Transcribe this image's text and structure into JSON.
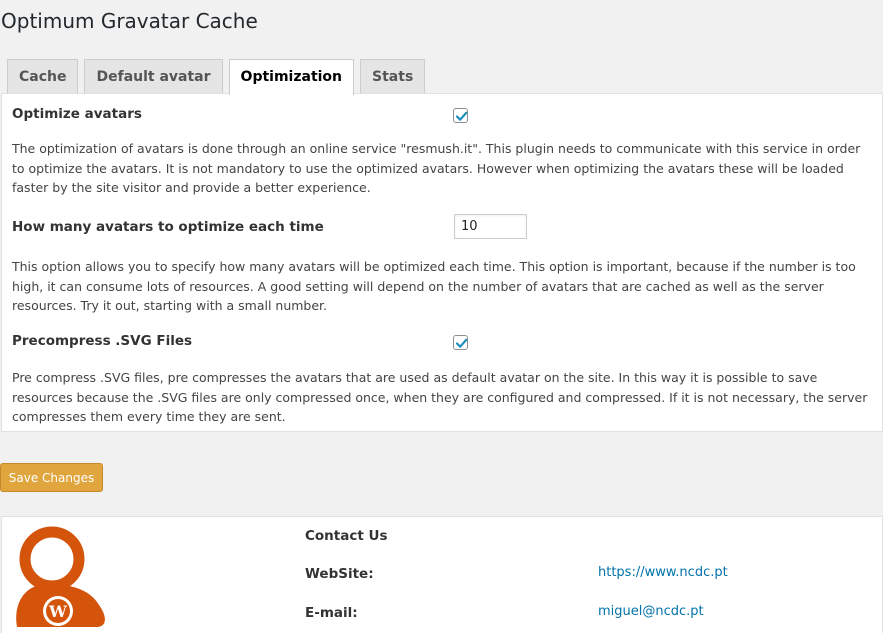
{
  "page": {
    "title": "Optimum Gravatar Cache"
  },
  "tabs": [
    {
      "label": "Cache"
    },
    {
      "label": "Default avatar"
    },
    {
      "label": "Optimization",
      "active": true
    },
    {
      "label": "Stats"
    }
  ],
  "optimization": {
    "optimize_avatars": {
      "label": "Optimize avatars",
      "checked": true,
      "description": "The optimization of avatars is done through an online service \"resmush.it\". This plugin needs to communicate with this service in order to optimize the avatars. It is not mandatory to use the optimized avatars. However when optimizing the avatars these will be loaded faster by the site visitor and provide a better experience."
    },
    "avatars_per_run": {
      "label": "How many avatars to optimize each time",
      "value": "10",
      "description": "This option allows you to specify how many avatars will be optimized each time. This option is important, because if the number is too high, it can consume lots of resources. A good setting will depend on the number of avatars that are cached as well as the server resources. Try it out, starting with a small number."
    },
    "precompress_svg": {
      "label": "Precompress .SVG Files",
      "checked": true,
      "description": "Pre compress .SVG files, pre compresses the avatars that are used as default avatar on the site. In this way it is possible to save resources because the .SVG files are only compressed once, when they are configured and compressed. If it is not necessary, the server compresses them every time they are sent."
    }
  },
  "actions": {
    "save_label": "Save Changes"
  },
  "contact": {
    "title": "Contact Us",
    "website_label": "WebSite:",
    "website_value": "https://www.ncdc.pt",
    "email_label": "E-mail:",
    "email_value": "miguel@ncdc.pt"
  },
  "colors": {
    "accent": "#e0a63d",
    "avatar": "#d4540b",
    "checkbox": "#1e8cbe",
    "link": "#0073aa"
  },
  "icons": {
    "checkbox_check": "checkmark-icon",
    "avatar_logo": "wordpress-avatar-icon"
  }
}
